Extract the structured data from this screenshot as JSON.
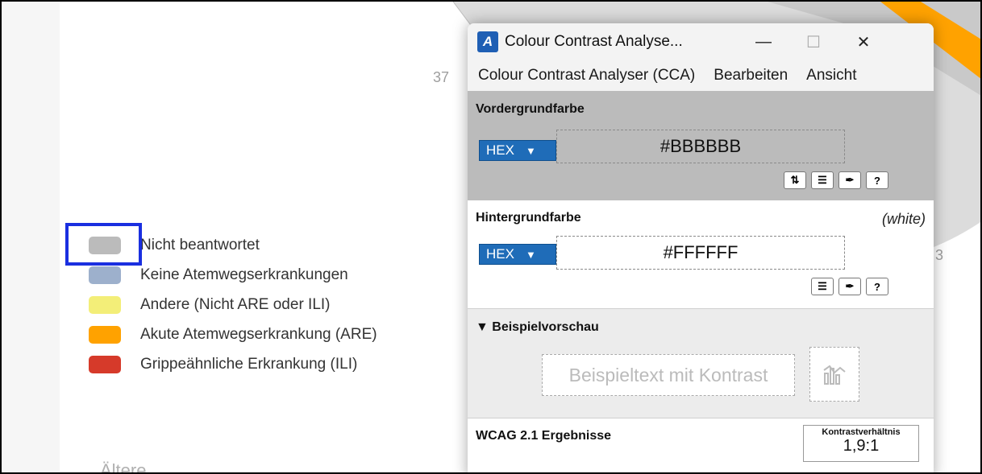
{
  "background": {
    "tick_labels": [
      "37",
      "3"
    ],
    "legend": [
      {
        "label": "Nicht beantwortet",
        "color": "#bbbbbb"
      },
      {
        "label": "Keine Atemwegserkrankungen",
        "color": "#9db0cc"
      },
      {
        "label": "Andere (Nicht ARE oder ILI)",
        "color": "#f3ee78"
      },
      {
        "label": "Akute Atemwegserkrankung (ARE)",
        "color": "#ffa200"
      },
      {
        "label": "Grippeähnliche Erkrankung (ILI)",
        "color": "#d63a2a"
      }
    ],
    "section_title": "Ältere",
    "highlight_color": "#1a2fe0"
  },
  "window": {
    "title": "Colour Contrast Analyse...",
    "buttons": {
      "minimize": "—",
      "maximize": "☐",
      "close": "✕"
    },
    "menu": [
      "Colour Contrast Analyser (CCA)",
      "Bearbeiten",
      "Ansicht"
    ]
  },
  "foreground": {
    "title": "Vordergrundfarbe",
    "format": "HEX",
    "value": "#BBBBBB",
    "color": "#bbbbbb"
  },
  "background_color": {
    "title": "Hintergrundfarbe",
    "name": "(white)",
    "format": "HEX",
    "value": "#FFFFFF",
    "color": "#ffffff"
  },
  "preview": {
    "title": "▼ Beispielvorschau",
    "sample_text": "Beispieltext mit Kontrast"
  },
  "results": {
    "title": "WCAG 2.1 Ergebnisse",
    "ratio_label": "Kontrastverhältnis",
    "ratio_value": "1,9:1"
  },
  "icons": {
    "swap": "swap-icon",
    "sliders": "sliders-icon",
    "eyedropper": "eyedropper-icon",
    "help": "help-icon",
    "chart": "chart-icon"
  }
}
